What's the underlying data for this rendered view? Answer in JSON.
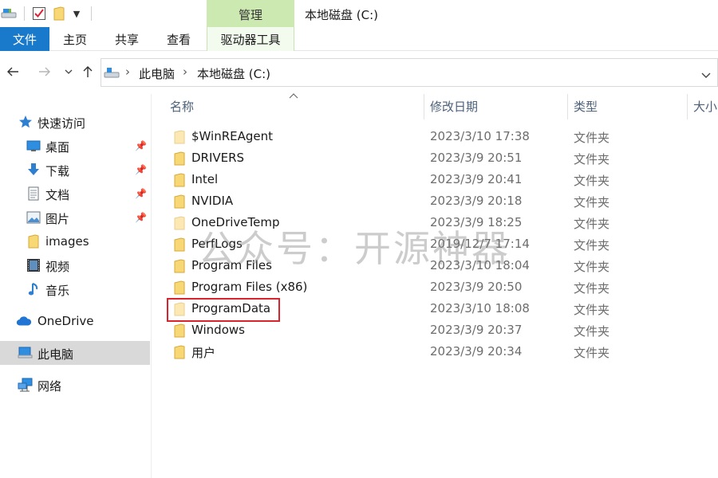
{
  "window": {
    "title": "本地磁盘 (C:)",
    "contextual_tab_group": "管理"
  },
  "ribbon": {
    "tabs": [
      {
        "label": "文件"
      },
      {
        "label": "主页"
      },
      {
        "label": "共享"
      },
      {
        "label": "查看"
      },
      {
        "label": "驱动器工具"
      }
    ]
  },
  "address": {
    "breadcrumb": [
      "此电脑",
      "本地磁盘 (C:)"
    ]
  },
  "sidebar": {
    "quick_access": "快速访问",
    "items": [
      {
        "label": "桌面",
        "icon": "desktop-icon",
        "pinned": true
      },
      {
        "label": "下载",
        "icon": "download-icon",
        "pinned": true
      },
      {
        "label": "文档",
        "icon": "document-icon",
        "pinned": true
      },
      {
        "label": "图片",
        "icon": "pictures-icon",
        "pinned": true
      },
      {
        "label": "images",
        "icon": "folder-icon",
        "pinned": false
      },
      {
        "label": "视频",
        "icon": "video-icon",
        "pinned": false
      },
      {
        "label": "音乐",
        "icon": "music-icon",
        "pinned": false
      }
    ],
    "onedrive": "OneDrive",
    "this_pc": "此电脑",
    "network": "网络"
  },
  "columns": {
    "name": "名称",
    "modified": "修改日期",
    "type": "类型",
    "size": "大小"
  },
  "files": [
    {
      "name": "$WinREAgent",
      "modified": "2023/3/10 17:38",
      "type": "文件夹",
      "hidden": true
    },
    {
      "name": "DRIVERS",
      "modified": "2023/3/9 20:51",
      "type": "文件夹",
      "hidden": false
    },
    {
      "name": "Intel",
      "modified": "2023/3/9 20:41",
      "type": "文件夹",
      "hidden": false
    },
    {
      "name": "NVIDIA",
      "modified": "2023/3/9 20:18",
      "type": "文件夹",
      "hidden": false
    },
    {
      "name": "OneDriveTemp",
      "modified": "2023/3/9 18:25",
      "type": "文件夹",
      "hidden": true
    },
    {
      "name": "PerfLogs",
      "modified": "2019/12/7 17:14",
      "type": "文件夹",
      "hidden": false
    },
    {
      "name": "Program Files",
      "modified": "2023/3/10 18:04",
      "type": "文件夹",
      "hidden": false
    },
    {
      "name": "Program Files (x86)",
      "modified": "2023/3/9 20:50",
      "type": "文件夹",
      "hidden": false
    },
    {
      "name": "ProgramData",
      "modified": "2023/3/10 18:08",
      "type": "文件夹",
      "hidden": true
    },
    {
      "name": "Windows",
      "modified": "2023/3/9 20:37",
      "type": "文件夹",
      "hidden": false
    },
    {
      "name": "用户",
      "modified": "2023/3/9 20:34",
      "type": "文件夹",
      "hidden": false
    }
  ],
  "highlighted_row_index": 8,
  "watermark": "公众号：开源神器",
  "colors": {
    "file_tab_bg": "#1979ca",
    "manage_tab_bg": "#cde9b2",
    "folder_yellow": "#f8d775",
    "highlight_red": "#d9232d",
    "selected_nav_bg": "#d9d9d9"
  }
}
